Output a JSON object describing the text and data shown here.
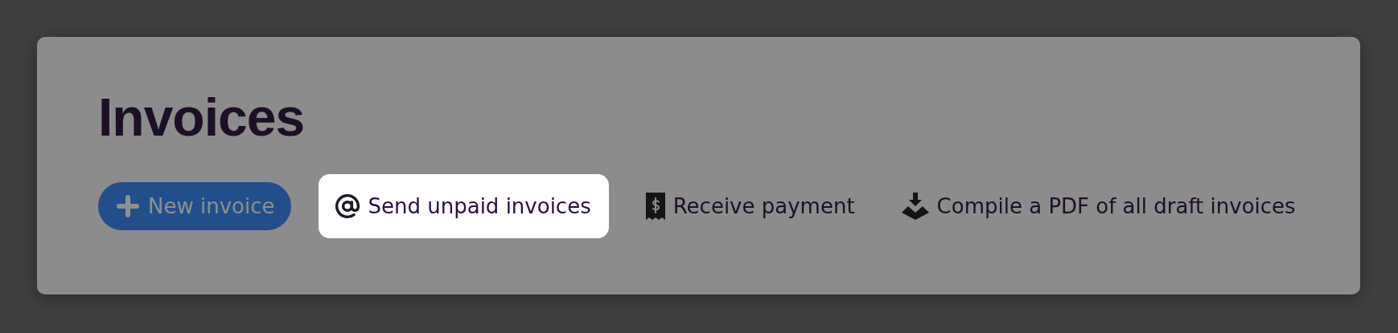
{
  "title": "Invoices",
  "actions": [
    {
      "label": "New invoice",
      "kind": "primary",
      "highlighted": false
    },
    {
      "label": "Send unpaid invoices",
      "kind": "email",
      "highlighted": true
    },
    {
      "label": "Receive payment",
      "kind": "payment",
      "highlighted": false
    },
    {
      "label": "Compile a PDF of all draft invoices",
      "kind": "download",
      "highlighted": false
    }
  ]
}
